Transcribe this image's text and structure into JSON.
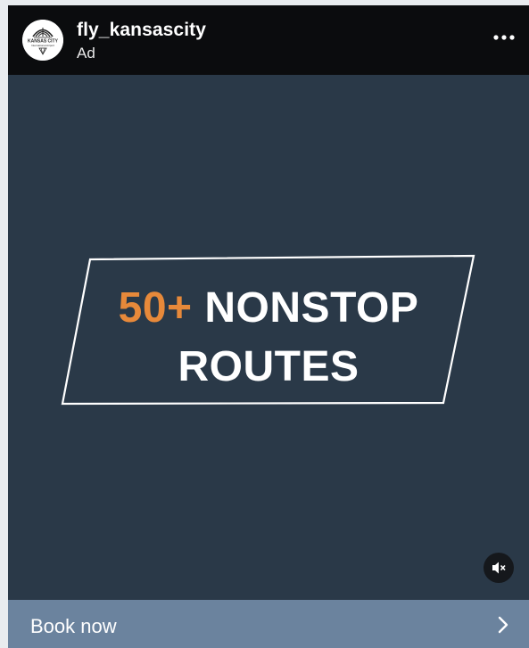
{
  "post": {
    "username": "fly_kansascity",
    "sponsor_label": "Ad",
    "avatar": {
      "icon": "kansas-city-airport-logo",
      "logo_text_top": "KANSAS CITY",
      "logo_text_bottom": "International Airport"
    },
    "more_icon": "more-horizontal-icon"
  },
  "ad": {
    "headline_accent": "50+",
    "headline_rest": " NONSTOP",
    "headline_line2": "ROUTES",
    "accent_color": "#e7893a",
    "background_color": "#2a3948"
  },
  "media_controls": {
    "mute_icon": "speaker-muted-icon"
  },
  "cta": {
    "label": "Book now",
    "icon": "chevron-right-icon",
    "background_color": "#6b839e"
  }
}
